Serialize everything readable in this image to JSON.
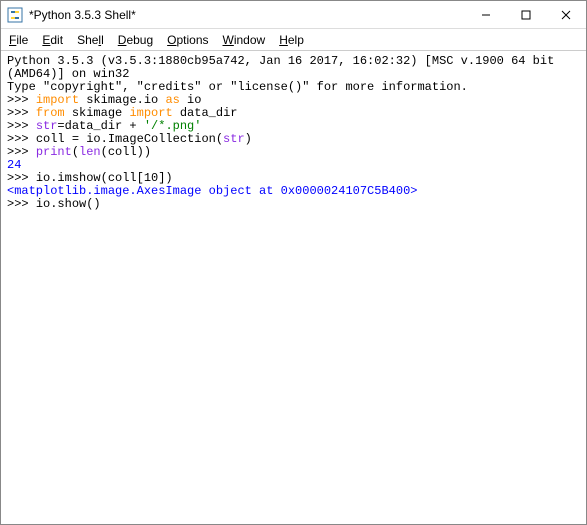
{
  "titlebar": {
    "title": "*Python 3.5.3 Shell*"
  },
  "menubar": {
    "file": "File",
    "edit": "Edit",
    "shell": "Shell",
    "debug": "Debug",
    "options": "Options",
    "window": "Window",
    "help": "Help"
  },
  "shell": {
    "header1": "Python 3.5.3 (v3.5.3:1880cb95a742, Jan 16 2017, 16:02:32) [MSC v.1900 64 bit (AMD64)] on win32",
    "header2": "Type \"copyright\", \"credits\" or \"license()\" for more information.",
    "prompt": ">>> ",
    "kw_import": "import",
    "kw_from": "from",
    "kw_as": "as",
    "line1_a": " skimage.io ",
    "line1_b": " io",
    "line2_a": " skimage ",
    "line2_b": " data_dir",
    "builtin_str": "str",
    "line3_a": "=data_dir + ",
    "str_lit": "'/*.png'",
    "line4_a": "coll = io.ImageCollection(",
    "line4_b": ")",
    "builtin_print": "print",
    "line5_a": "(",
    "builtin_len": "len",
    "line5_b": "(coll))",
    "out1": "24",
    "line6": "io.imshow(coll[10])",
    "out2": "<matplotlib.image.AxesImage object at 0x0000024107C5B400>",
    "line7": "io.show()"
  }
}
